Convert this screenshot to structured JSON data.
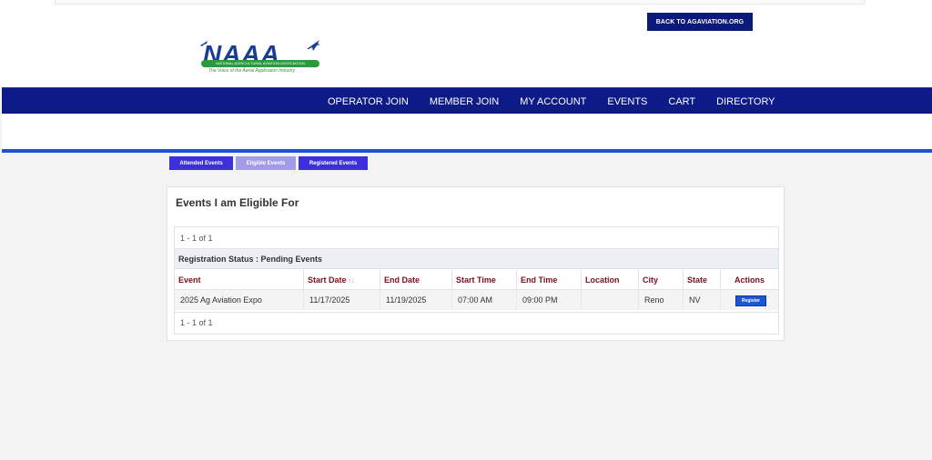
{
  "header": {
    "back_button": "BACK TO AGAVIATION.ORG",
    "logo": {
      "name": "NAAA",
      "band_text": "NATIONAL AGRICULTURAL AVIATION ASSOCIATION",
      "tagline": "The Voice of the Aerial Application Industry"
    }
  },
  "nav": {
    "items": [
      "OPERATOR JOIN",
      "MEMBER JOIN",
      "MY ACCOUNT",
      "EVENTS",
      "CART",
      "DIRECTORY"
    ]
  },
  "tabs": {
    "attended": "Attended Events",
    "eligible": "Eligible Events",
    "registered": "Registered Events"
  },
  "panel": {
    "title": "Events I am Eligible For",
    "pager_top": "1 - 1 of 1",
    "pager_bottom": "1 - 1 of 1",
    "group_label": "Registration Status : Pending Events",
    "columns": [
      "Event",
      "Start Date",
      "End Date",
      "Start Time",
      "End Time",
      "Location",
      "City",
      "State",
      "Actions"
    ],
    "rows": [
      {
        "event": "2025 Ag Aviation Expo",
        "start_date": "11/17/2025",
        "end_date": "11/19/2025",
        "start_time": "07:00 AM",
        "end_time": "09:00 PM",
        "location": "",
        "city": "Reno",
        "state": "NV",
        "action": "Register"
      }
    ]
  },
  "colors": {
    "nav_bg": "#0d1a87",
    "accent_line": "#1f4fd6",
    "tab_active": "#3d2fd9",
    "tab_selected": "#a29be6",
    "header_text": "#7a1020"
  }
}
